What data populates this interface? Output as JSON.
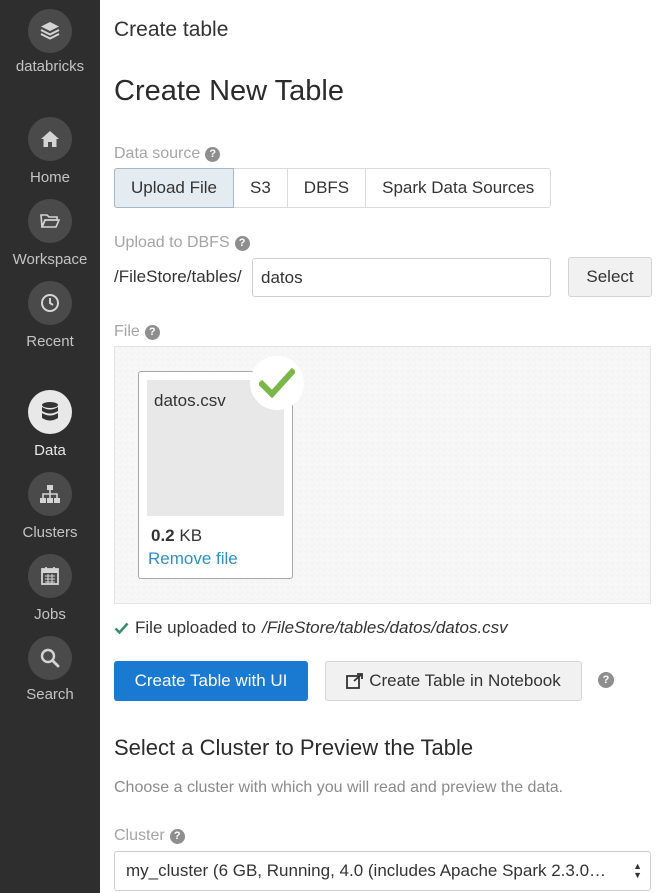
{
  "sidebar": {
    "brand": "databricks",
    "items": [
      {
        "label": "Home",
        "icon": "home-icon"
      },
      {
        "label": "Workspace",
        "icon": "folder-icon"
      },
      {
        "label": "Recent",
        "icon": "clock-icon"
      },
      {
        "label": "Data",
        "icon": "database-icon",
        "active": true
      },
      {
        "label": "Clusters",
        "icon": "clusters-icon"
      },
      {
        "label": "Jobs",
        "icon": "calendar-icon"
      },
      {
        "label": "Search",
        "icon": "search-icon"
      }
    ]
  },
  "breadcrumb": "Create table",
  "page_title": "Create New Table",
  "data_source": {
    "label": "Data source",
    "tabs": [
      "Upload File",
      "S3",
      "DBFS",
      "Spark Data Sources"
    ],
    "active_tab": "Upload File"
  },
  "upload_dbfs": {
    "label": "Upload to DBFS",
    "prefix": "/FileStore/tables/",
    "value": "datos",
    "select_label": "Select"
  },
  "file": {
    "label": "File",
    "name": "datos.csv",
    "size_value": "0.2",
    "size_unit": "KB",
    "remove_label": "Remove file"
  },
  "upload_status": {
    "text": "File uploaded to",
    "path": "/FileStore/tables/datos/datos.csv"
  },
  "actions": {
    "create_ui": "Create Table with UI",
    "create_notebook": "Create Table in Notebook"
  },
  "cluster_section": {
    "title": "Select a Cluster to Preview the Table",
    "description": "Choose a cluster with which you will read and preview the data.",
    "label": "Cluster",
    "selected": "my_cluster (6 GB, Running, 4.0 (includes Apache Spark 2.3.0…"
  },
  "colors": {
    "sidebar_bg": "#2e2e2e",
    "primary": "#1a79d0",
    "link": "#2f8fbf",
    "success": "#7ab648"
  }
}
